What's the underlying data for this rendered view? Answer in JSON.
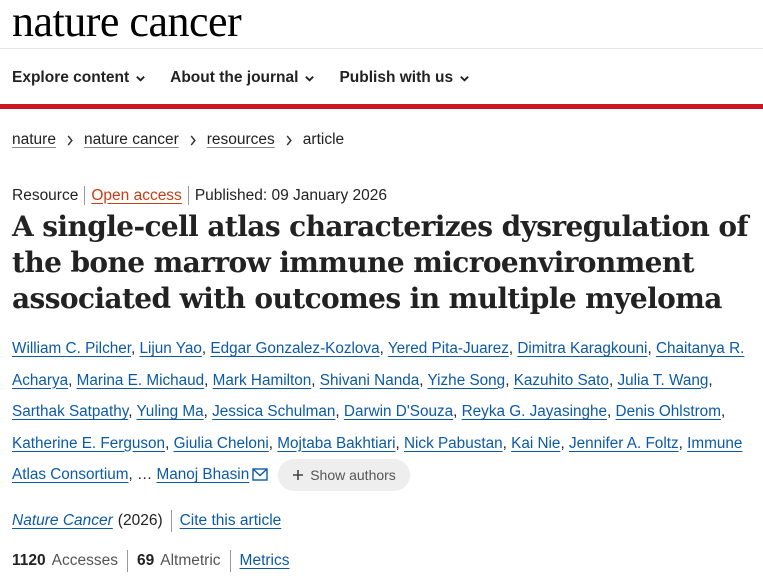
{
  "header": {
    "logo": "nature cancer",
    "nav": [
      {
        "label": "Explore content"
      },
      {
        "label": "About the journal"
      },
      {
        "label": "Publish with us"
      }
    ]
  },
  "breadcrumb": {
    "items": [
      "nature",
      "nature cancer",
      "resources"
    ],
    "current": "article"
  },
  "article": {
    "type": "Resource",
    "access": "Open access",
    "published": "Published: 09 January 2026",
    "title": "A single-cell atlas characterizes dysregulation of the bone marrow immune microenvironment associated with outcomes in multiple myeloma",
    "authors": [
      "William C. Pilcher",
      "Lijun Yao",
      "Edgar Gonzalez-Kozlova",
      "Yered Pita-Juarez",
      "Dimitra Karagkouni",
      "Chaitanya R. Acharya",
      "Marina E. Michaud",
      "Mark Hamilton",
      "Shivani Nanda",
      "Yizhe Song",
      "Kazuhito Sato",
      "Julia T. Wang",
      "Sarthak Satpathy",
      "Yuling Ma",
      "Jessica Schulman",
      "Darwin D'Souza",
      "Reyka G. Jayasinghe",
      "Denis Ohlstrom",
      "Katherine E. Ferguson",
      "Giulia Cheloni",
      "Mojtaba Bakhtiari",
      "Nick Pabustan",
      "Kai Nie",
      "Jennifer A. Foltz",
      "Immune Atlas Consortium"
    ],
    "ellipsis": "…",
    "corresponding_author": "Manoj Bhasin",
    "show_authors_label": "Show authors",
    "journal": "Nature Cancer",
    "year": "(2026)",
    "cite_label": "Cite this article",
    "accesses_value": "1120",
    "accesses_label": "Accesses",
    "altmetric_value": "69",
    "altmetric_label": "Altmetric",
    "metrics_label": "Metrics"
  },
  "colors": {
    "accent_red": "#cc1424",
    "link_blue": "#0c5aa6",
    "open_access": "#c63d16"
  }
}
